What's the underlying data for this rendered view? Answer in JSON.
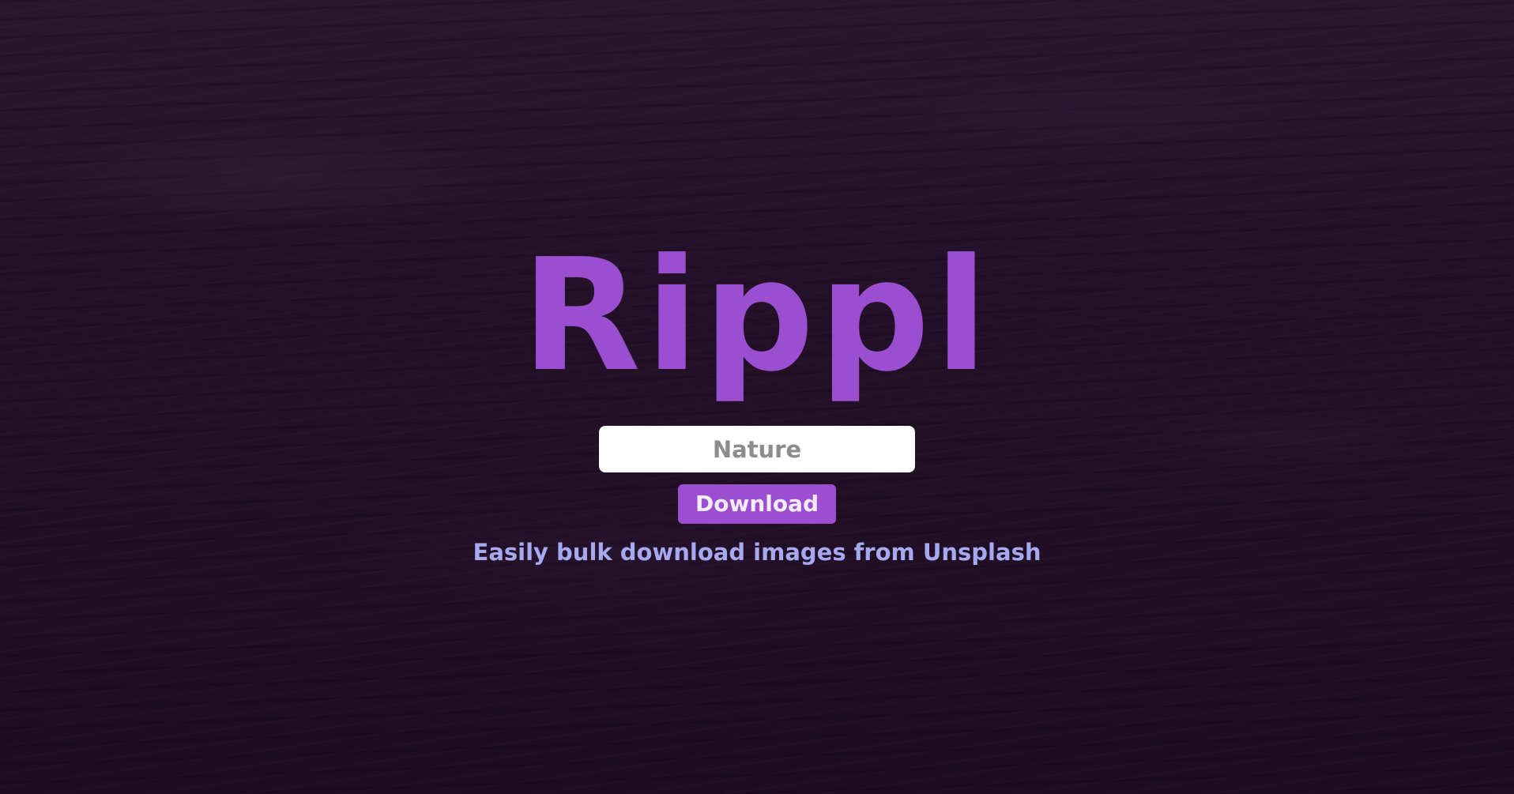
{
  "app": {
    "title": "Rippl"
  },
  "search": {
    "placeholder": "Nature",
    "value": ""
  },
  "actions": {
    "download_label": "Download"
  },
  "tagline": "Easily bulk download images from Unsplash",
  "colors": {
    "accent": "#9b4fd0",
    "background": "#1f0f24",
    "tagline": "#a6a9f0",
    "input_background": "#ffffff",
    "placeholder": "#8c8c8c"
  }
}
